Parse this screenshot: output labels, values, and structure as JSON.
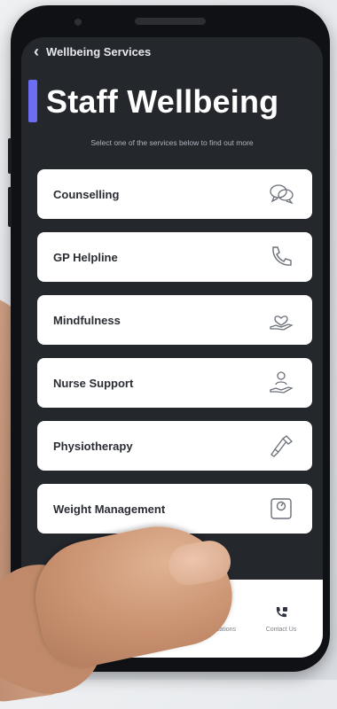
{
  "header": {
    "back_label": "Wellbeing Services"
  },
  "page": {
    "title": "Staff Wellbeing",
    "subtitle": "Select one of the services below to find out more"
  },
  "services": [
    {
      "label": "Counselling",
      "icon": "chat-bubbles-icon"
    },
    {
      "label": "GP Helpline",
      "icon": "phone-icon"
    },
    {
      "label": "Mindfulness",
      "icon": "heart-hand-icon"
    },
    {
      "label": "Nurse Support",
      "icon": "person-hand-icon"
    },
    {
      "label": "Physiotherapy",
      "icon": "massage-gun-icon"
    },
    {
      "label": "Weight Management",
      "icon": "scale-icon"
    }
  ],
  "bottom_nav": {
    "notifications_label": "Notifications",
    "contact_label": "Contact Us"
  },
  "colors": {
    "accent": "#6b6df2",
    "screen_bg": "#24272c",
    "card_bg": "#ffffff"
  }
}
